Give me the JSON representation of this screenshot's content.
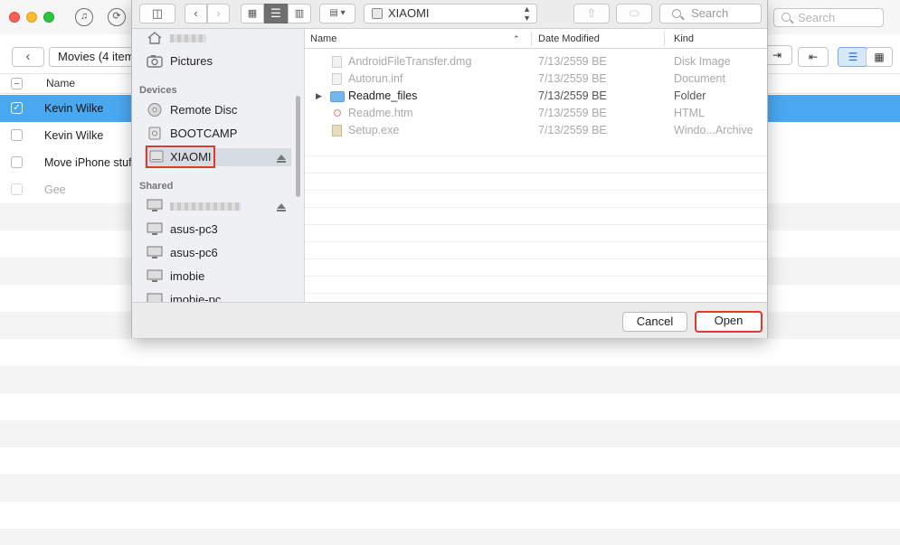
{
  "app": {
    "toolbar": {
      "back_label": "‹",
      "movies_label": "Movies (4 item",
      "music_icon": "♫",
      "refresh_icon": "⟳"
    },
    "search": {
      "placeholder": "Search"
    },
    "header": {
      "name_label": "Name"
    },
    "rows": [
      {
        "name": "Kevin Wilke",
        "checked": true
      },
      {
        "name": "Kevin Wilke",
        "checked": false
      },
      {
        "name": "Move iPhone stuff",
        "checked": false
      },
      {
        "name": "Gee",
        "checked": false
      }
    ]
  },
  "dialog": {
    "location": "XIAOMI",
    "search_placeholder": "Search",
    "sidebar": {
      "pictures": "Pictures",
      "devices_header": "Devices",
      "devices": [
        "Remote Disc",
        "BOOTCAMP",
        "XIAOMI"
      ],
      "shared_header": "Shared",
      "shared": [
        "asus-pc3",
        "asus-pc6",
        "imobie",
        "imobie-pc"
      ]
    },
    "columns": {
      "name": "Name",
      "date": "Date Modified",
      "kind": "Kind"
    },
    "files": [
      {
        "name": "AndroidFileTransfer.dmg",
        "date": "7/13/2559 BE",
        "kind": "Disk Image",
        "enabled": false
      },
      {
        "name": "Autorun.inf",
        "date": "7/13/2559 BE",
        "kind": "Document",
        "enabled": false
      },
      {
        "name": "Readme_files",
        "date": "7/13/2559 BE",
        "kind": "Folder",
        "enabled": true
      },
      {
        "name": "Readme.htm",
        "date": "7/13/2559 BE",
        "kind": "HTML",
        "enabled": false
      },
      {
        "name": "Setup.exe",
        "date": "7/13/2559 BE",
        "kind": "Windo...Archive",
        "enabled": false
      }
    ],
    "buttons": {
      "cancel": "Cancel",
      "open": "Open"
    }
  },
  "colors": {
    "selection": "#4aa8f0",
    "highlight_box": "#e03a2e"
  }
}
